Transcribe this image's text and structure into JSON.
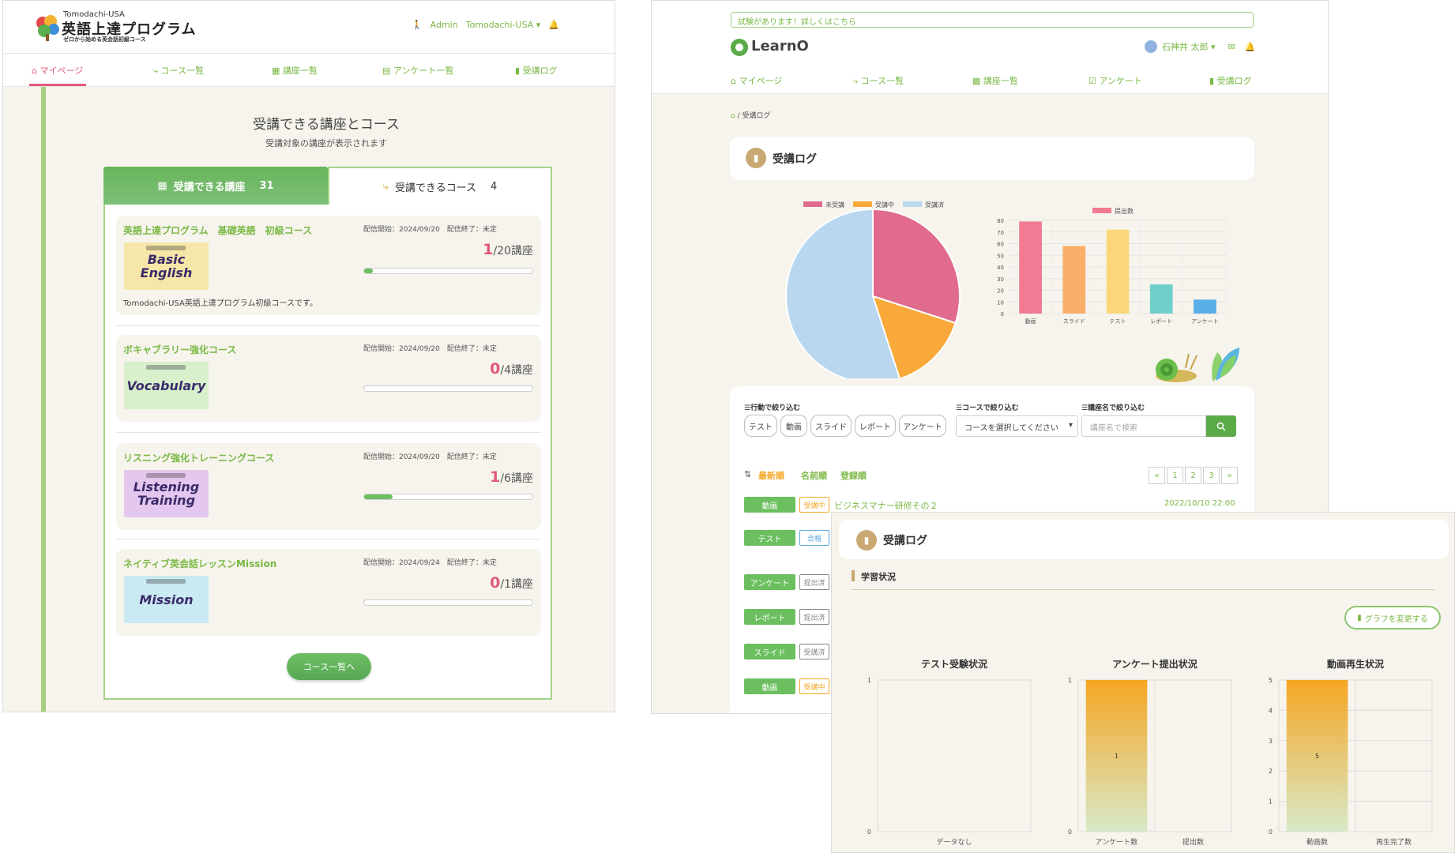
{
  "panel1": {
    "logo": {
      "top": "Tomodachi-USA",
      "main": "英語上達プログラム",
      "sub": "ゼロから始める英会話初級コース"
    },
    "user": {
      "role": "Admin",
      "org": "Tomodachi-USA ▾"
    },
    "nav": [
      "マイページ",
      "コース一覧",
      "講座一覧",
      "アンケート一覧",
      "受講ログ"
    ],
    "section_title": "受講できる講座とコース",
    "section_sub": "受講対象の講座が表示されます",
    "tab_lectures": {
      "label": "受講できる講座",
      "count": "31"
    },
    "tab_courses": {
      "label": "受講できるコース",
      "count": "4"
    },
    "courses": [
      {
        "title": "英語上達プログラム　基礎英語　初級コース",
        "date": "配信開始：2024/09/20　配信終了：未定",
        "done": "1",
        "total": "/20講座",
        "progress": 0.05,
        "thumb": "Basic English",
        "thumb_color": "#f6e7a8",
        "desc": "Tomodachi-USA英語上達プログラム初級コースです。"
      },
      {
        "title": "ボキャブラリー強化コース",
        "date": "配信開始：2024/09/20　配信終了：未定",
        "done": "0",
        "total": "/4講座",
        "progress": 0,
        "thumb": "Vocabulary",
        "thumb_color": "#d8f0cc",
        "desc": ""
      },
      {
        "title": "リスニング強化トレーニングコース",
        "date": "配信開始：2024/09/20　配信終了：未定",
        "done": "1",
        "total": "/6講座",
        "progress": 0.17,
        "thumb": "Listening Training",
        "thumb_color": "#e4c7ee",
        "desc": ""
      },
      {
        "title": "ネイティブ英会話レッスンMission",
        "date": "配信開始：2024/09/24　配信終了：未定",
        "done": "0",
        "total": "/1講座",
        "progress": 0,
        "thumb": "Mission",
        "thumb_color": "#c9eaf3",
        "desc": ""
      }
    ],
    "button": "コース一覧へ"
  },
  "panel2": {
    "notice": "試験があります！詳しくはこちら",
    "logo": "LearnO",
    "user": "石神井 太郎 ▾",
    "nav": [
      "マイページ",
      "コース一覧",
      "講座一覧",
      "アンケート",
      "受講ログ"
    ],
    "breadcrumb": "/ 受講ログ",
    "title": "受講ログ",
    "filters": {
      "action_label": "行動で絞り込む",
      "course_label": "コースで絞り込む",
      "name_label": "講座名で絞り込む",
      "chips": [
        "テスト",
        "動画",
        "スライド",
        "レポート",
        "アンケート"
      ],
      "course_select": "コースを選択してください",
      "search_placeholder": "講座名で検索"
    },
    "sort": [
      "最新順",
      "名前順",
      "登録順"
    ],
    "pager": [
      "«",
      "1",
      "2",
      "3",
      "»"
    ],
    "rows": [
      {
        "tag": "動画",
        "status": "受講中",
        "status_color": "#f5a623",
        "name": "ビジネスマナー研修その２",
        "date": "2022/10/10 22:00"
      },
      {
        "tag": "テスト",
        "status": "合格",
        "status_color": "#5aa7e0",
        "name": "",
        "date": ""
      },
      {
        "tag": "アンケート",
        "status": "提出済",
        "status_color": "#888888",
        "name": "",
        "date": ""
      },
      {
        "tag": "レポート",
        "status": "提出済",
        "status_color": "#888888",
        "name": "",
        "date": ""
      },
      {
        "tag": "スライド",
        "status": "受講済",
        "status_color": "#888888",
        "name": "",
        "date": ""
      },
      {
        "tag": "動画",
        "status": "受講中",
        "status_color": "#f5a623",
        "name": "",
        "date": ""
      }
    ]
  },
  "panel3": {
    "title": "受講ログ",
    "section": "学習状況",
    "button": "グラフを変更する"
  },
  "chart_data": [
    {
      "type": "pie",
      "legend": [
        "未受講",
        "受講中",
        "受講済"
      ],
      "values": [
        30,
        15,
        55
      ],
      "colors": [
        "#e06b8d",
        "#f9a93a",
        "#b9d7ef"
      ],
      "legend_placement": "top"
    },
    {
      "type": "bar",
      "legend": [
        "提出数"
      ],
      "categories": [
        "動画",
        "スライド",
        "テスト",
        "レポート",
        "アンケート"
      ],
      "values": [
        79,
        58,
        72,
        25,
        12
      ],
      "colors": [
        "#f27a93",
        "#f9ae69",
        "#fbd779",
        "#6fcfcb",
        "#5aaee8"
      ],
      "ylim": [
        0,
        80
      ],
      "yticks": [
        "0",
        "10",
        "20",
        "30",
        "40",
        "50",
        "60",
        "70",
        "80"
      ],
      "grid": true
    },
    {
      "type": "bar",
      "title": "テスト受験状況",
      "categories": [
        "データなし"
      ],
      "values": [
        0
      ],
      "ylim": [
        0,
        1
      ],
      "yticks": [
        "0",
        "1"
      ]
    },
    {
      "type": "bar",
      "title": "アンケート提出状況",
      "categories": [
        "アンケート数",
        "提出数"
      ],
      "values": [
        1,
        0
      ],
      "data_labels": [
        "1",
        ""
      ],
      "ylim": [
        0,
        1
      ],
      "yticks": [
        "0",
        "1"
      ]
    },
    {
      "type": "bar",
      "title": "動画再生状況",
      "categories": [
        "動画数",
        "再生完了数"
      ],
      "values": [
        5,
        0
      ],
      "data_labels": [
        "5",
        ""
      ],
      "ylim": [
        0,
        5
      ],
      "yticks": [
        "0",
        "1",
        "2",
        "3",
        "4",
        "5"
      ]
    }
  ]
}
